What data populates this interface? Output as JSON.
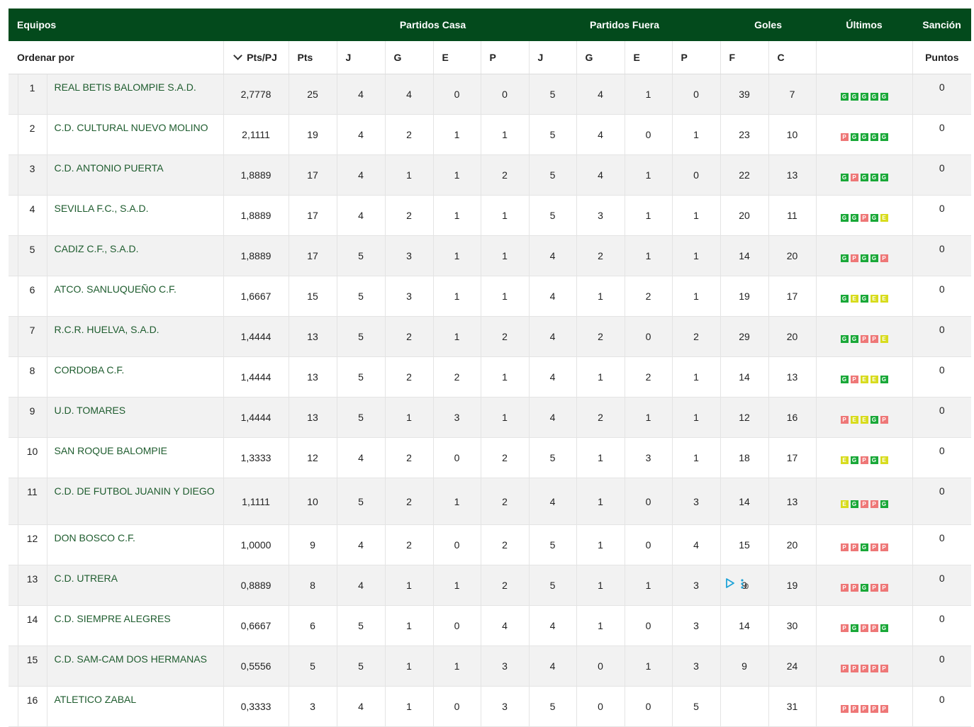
{
  "header": {
    "equipos": "Equipos",
    "partidos_casa": "Partidos Casa",
    "partidos_fuera": "Partidos Fuera",
    "goles": "Goles",
    "ultimos": "Últimos",
    "sancion": "Sanción"
  },
  "subheader": {
    "ordenar_por": "Ordenar por",
    "pts_pj": "Pts/PJ",
    "pts": "Pts",
    "casa_j": "J",
    "casa_g": "G",
    "casa_e": "E",
    "casa_p": "P",
    "fuera_j": "J",
    "fuera_g": "G",
    "fuera_e": "E",
    "fuera_p": "P",
    "f": "F",
    "c": "C",
    "puntos": "Puntos"
  },
  "colors": {
    "header_bg": "#034a1c",
    "win": "#19a838",
    "loss": "#ee7777",
    "draw": "#d8dc1e",
    "team_text": "#1e5c2e"
  },
  "rows": [
    {
      "pos": "1",
      "team": "REAL BETIS BALOMPIE S.A.D.",
      "ptspj": "2,7778",
      "pts": "25",
      "cj": "4",
      "cg": "4",
      "ce": "0",
      "cp": "0",
      "fj": "5",
      "fg": "4",
      "fe": "1",
      "fp": "0",
      "gf": "39",
      "gc": "7",
      "last": [
        "G",
        "G",
        "G",
        "G",
        "G"
      ],
      "sancion": "0"
    },
    {
      "pos": "2",
      "team": "C.D. CULTURAL NUEVO MOLINO",
      "ptspj": "2,1111",
      "pts": "19",
      "cj": "4",
      "cg": "2",
      "ce": "1",
      "cp": "1",
      "fj": "5",
      "fg": "4",
      "fe": "0",
      "fp": "1",
      "gf": "23",
      "gc": "10",
      "last": [
        "P",
        "G",
        "G",
        "G",
        "G"
      ],
      "sancion": "0"
    },
    {
      "pos": "3",
      "team": "C.D. ANTONIO PUERTA",
      "ptspj": "1,8889",
      "pts": "17",
      "cj": "4",
      "cg": "1",
      "ce": "1",
      "cp": "2",
      "fj": "5",
      "fg": "4",
      "fe": "1",
      "fp": "0",
      "gf": "22",
      "gc": "13",
      "last": [
        "G",
        "P",
        "G",
        "G",
        "G"
      ],
      "sancion": "0"
    },
    {
      "pos": "4",
      "team": "SEVILLA F.C., S.A.D.",
      "ptspj": "1,8889",
      "pts": "17",
      "cj": "4",
      "cg": "2",
      "ce": "1",
      "cp": "1",
      "fj": "5",
      "fg": "3",
      "fe": "1",
      "fp": "1",
      "gf": "20",
      "gc": "11",
      "last": [
        "G",
        "G",
        "P",
        "G",
        "E"
      ],
      "sancion": "0"
    },
    {
      "pos": "5",
      "team": "CADIZ C.F., S.A.D.",
      "ptspj": "1,8889",
      "pts": "17",
      "cj": "5",
      "cg": "3",
      "ce": "1",
      "cp": "1",
      "fj": "4",
      "fg": "2",
      "fe": "1",
      "fp": "1",
      "gf": "14",
      "gc": "20",
      "last": [
        "G",
        "P",
        "G",
        "G",
        "P"
      ],
      "sancion": "0"
    },
    {
      "pos": "6",
      "team": "ATCO. SANLUQUEÑO C.F.",
      "ptspj": "1,6667",
      "pts": "15",
      "cj": "5",
      "cg": "3",
      "ce": "1",
      "cp": "1",
      "fj": "4",
      "fg": "1",
      "fe": "2",
      "fp": "1",
      "gf": "19",
      "gc": "17",
      "last": [
        "G",
        "E",
        "G",
        "E",
        "E"
      ],
      "sancion": "0"
    },
    {
      "pos": "7",
      "team": "R.C.R. HUELVA, S.A.D.",
      "ptspj": "1,4444",
      "pts": "13",
      "cj": "5",
      "cg": "2",
      "ce": "1",
      "cp": "2",
      "fj": "4",
      "fg": "2",
      "fe": "0",
      "fp": "2",
      "gf": "29",
      "gc": "20",
      "last": [
        "G",
        "G",
        "P",
        "P",
        "E"
      ],
      "sancion": "0"
    },
    {
      "pos": "8",
      "team": "CORDOBA C.F.",
      "ptspj": "1,4444",
      "pts": "13",
      "cj": "5",
      "cg": "2",
      "ce": "2",
      "cp": "1",
      "fj": "4",
      "fg": "1",
      "fe": "2",
      "fp": "1",
      "gf": "14",
      "gc": "13",
      "last": [
        "G",
        "P",
        "E",
        "E",
        "G"
      ],
      "sancion": "0"
    },
    {
      "pos": "9",
      "team": "U.D. TOMARES",
      "ptspj": "1,4444",
      "pts": "13",
      "cj": "5",
      "cg": "1",
      "ce": "3",
      "cp": "1",
      "fj": "4",
      "fg": "2",
      "fe": "1",
      "fp": "1",
      "gf": "12",
      "gc": "16",
      "last": [
        "P",
        "E",
        "E",
        "G",
        "P"
      ],
      "sancion": "0"
    },
    {
      "pos": "10",
      "team": "SAN ROQUE BALOMPIE",
      "ptspj": "1,3333",
      "pts": "12",
      "cj": "4",
      "cg": "2",
      "ce": "0",
      "cp": "2",
      "fj": "5",
      "fg": "1",
      "fe": "3",
      "fp": "1",
      "gf": "18",
      "gc": "17",
      "last": [
        "E",
        "G",
        "P",
        "G",
        "E"
      ],
      "sancion": "0"
    },
    {
      "pos": "11",
      "team": "C.D. DE FUTBOL JUANIN Y DIEGO",
      "ptspj": "1,1111",
      "pts": "10",
      "cj": "5",
      "cg": "2",
      "ce": "1",
      "cp": "2",
      "fj": "4",
      "fg": "1",
      "fe": "0",
      "fp": "3",
      "gf": "14",
      "gc": "13",
      "last": [
        "E",
        "G",
        "P",
        "P",
        "G"
      ],
      "sancion": "0"
    },
    {
      "pos": "12",
      "team": "DON BOSCO C.F.",
      "ptspj": "1,0000",
      "pts": "9",
      "cj": "4",
      "cg": "2",
      "ce": "0",
      "cp": "2",
      "fj": "5",
      "fg": "1",
      "fe": "0",
      "fp": "4",
      "gf": "15",
      "gc": "20",
      "last": [
        "P",
        "P",
        "G",
        "P",
        "P"
      ],
      "sancion": "0"
    },
    {
      "pos": "13",
      "team": "C.D. UTRERA",
      "ptspj": "0,8889",
      "pts": "8",
      "cj": "4",
      "cg": "1",
      "ce": "1",
      "cp": "2",
      "fj": "5",
      "fg": "1",
      "fe": "1",
      "fp": "3",
      "gf": "9",
      "gc": "19",
      "last": [
        "P",
        "P",
        "G",
        "P",
        "P"
      ],
      "sancion": "0"
    },
    {
      "pos": "14",
      "team": "C.D. SIEMPRE ALEGRES",
      "ptspj": "0,6667",
      "pts": "6",
      "cj": "5",
      "cg": "1",
      "ce": "0",
      "cp": "4",
      "fj": "4",
      "fg": "1",
      "fe": "0",
      "fp": "3",
      "gf": "14",
      "gc": "30",
      "last": [
        "P",
        "G",
        "P",
        "P",
        "G"
      ],
      "sancion": "0"
    },
    {
      "pos": "15",
      "team": "C.D. SAM-CAM DOS HERMANAS",
      "ptspj": "0,5556",
      "pts": "5",
      "cj": "5",
      "cg": "1",
      "ce": "1",
      "cp": "3",
      "fj": "4",
      "fg": "0",
      "fe": "1",
      "fp": "3",
      "gf": "9",
      "gc": "24",
      "last": [
        "P",
        "P",
        "P",
        "P",
        "P"
      ],
      "sancion": "0"
    },
    {
      "pos": "16",
      "team": "ATLETICO ZABAL",
      "ptspj": "0,3333",
      "pts": "3",
      "cj": "4",
      "cg": "1",
      "ce": "0",
      "cp": "3",
      "fj": "5",
      "fg": "0",
      "fe": "0",
      "fp": "5",
      "gf": "",
      "gc": "31",
      "last": [
        "P",
        "P",
        "P",
        "P",
        "P"
      ],
      "sancion": "0"
    }
  ]
}
